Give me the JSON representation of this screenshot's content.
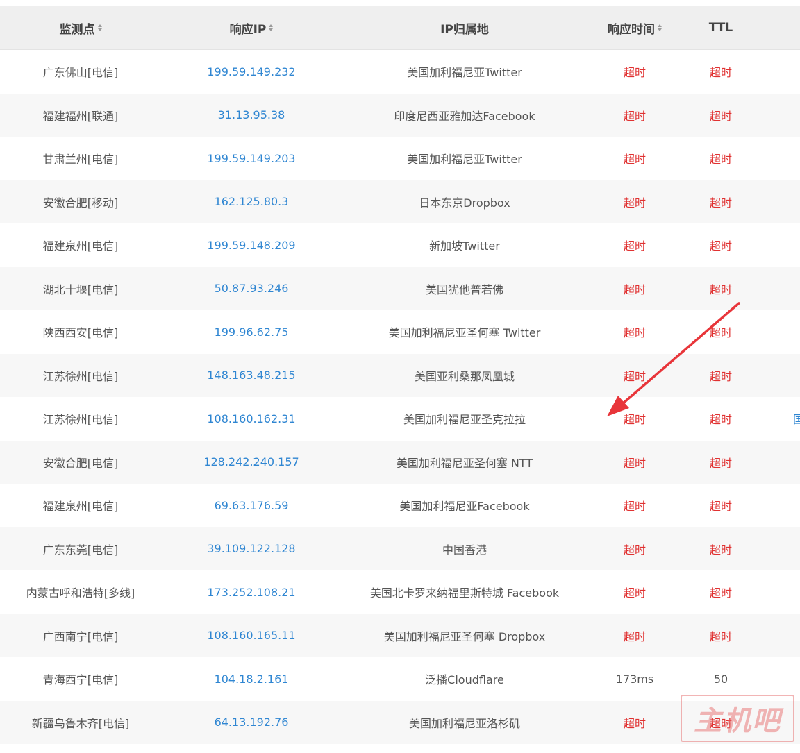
{
  "table": {
    "headers": {
      "monitor": "监测点",
      "ip": "响应IP",
      "location": "IP归属地",
      "response_time": "响应时间",
      "ttl": "TTL"
    },
    "rows": [
      {
        "monitor": "广东佛山[电信]",
        "ip": "199.59.149.232",
        "location": "美国加利福尼亚Twitter",
        "time": "超时",
        "ttl": "超时"
      },
      {
        "monitor": "福建福州[联通]",
        "ip": "31.13.95.38",
        "location": "印度尼西亚雅加达Facebook",
        "time": "超时",
        "ttl": "超时"
      },
      {
        "monitor": "甘肃兰州[电信]",
        "ip": "199.59.149.203",
        "location": "美国加利福尼亚Twitter",
        "time": "超时",
        "ttl": "超时"
      },
      {
        "monitor": "安徽合肥[移动]",
        "ip": "162.125.80.3",
        "location": "日本东京Dropbox",
        "time": "超时",
        "ttl": "超时"
      },
      {
        "monitor": "福建泉州[电信]",
        "ip": "199.59.148.209",
        "location": "新加坡Twitter",
        "time": "超时",
        "ttl": "超时"
      },
      {
        "monitor": "湖北十堰[电信]",
        "ip": "50.87.93.246",
        "location": "美国犹他普若佛",
        "time": "超时",
        "ttl": "超时"
      },
      {
        "monitor": "陕西西安[电信]",
        "ip": "199.96.62.75",
        "location": "美国加利福尼亚圣何塞 Twitter",
        "time": "超时",
        "ttl": "超时"
      },
      {
        "monitor": "江苏徐州[电信]",
        "ip": "148.163.48.215",
        "location": "美国亚利桑那凤凰城",
        "time": "超时",
        "ttl": "超时"
      },
      {
        "monitor": "江苏徐州[电信]",
        "ip": "108.160.162.31",
        "location": "美国加利福尼亚圣克拉拉",
        "time": "超时",
        "ttl": "超时",
        "edge": "国"
      },
      {
        "monitor": "安徽合肥[电信]",
        "ip": "128.242.240.157",
        "location": "美国加利福尼亚圣何塞 NTT",
        "time": "超时",
        "ttl": "超时"
      },
      {
        "monitor": "福建泉州[电信]",
        "ip": "69.63.176.59",
        "location": "美国加利福尼亚Facebook",
        "time": "超时",
        "ttl": "超时"
      },
      {
        "monitor": "广东东莞[电信]",
        "ip": "39.109.122.128",
        "location": "中国香港",
        "time": "超时",
        "ttl": "超时"
      },
      {
        "monitor": "内蒙古呼和浩特[多线]",
        "ip": "173.252.108.21",
        "location": "美国北卡罗来纳福里斯特城 Facebook",
        "time": "超时",
        "ttl": "超时"
      },
      {
        "monitor": "广西南宁[电信]",
        "ip": "108.160.165.11",
        "location": "美国加利福尼亚圣何塞 Dropbox",
        "time": "超时",
        "ttl": "超时"
      },
      {
        "monitor": "青海西宁[电信]",
        "ip": "104.18.2.161",
        "location": "泛播Cloudflare",
        "time": "173ms",
        "ttl": "50"
      },
      {
        "monitor": "新疆乌鲁木齐[电信]",
        "ip": "64.13.192.76",
        "location": "美国加利福尼亚洛杉矶",
        "time": "超时",
        "ttl": "超时"
      }
    ]
  },
  "watermark": {
    "text": "主机吧"
  },
  "colors": {
    "ip_link": "#2f86d2",
    "timeout": "#e03131",
    "annotation_arrow": "#e8353a",
    "header_bg": "#efefef",
    "alt_row_bg": "#f7f7f7"
  },
  "icons": {
    "sort": "sort-caret-icon",
    "annotation": "red-arrow-annotation"
  }
}
